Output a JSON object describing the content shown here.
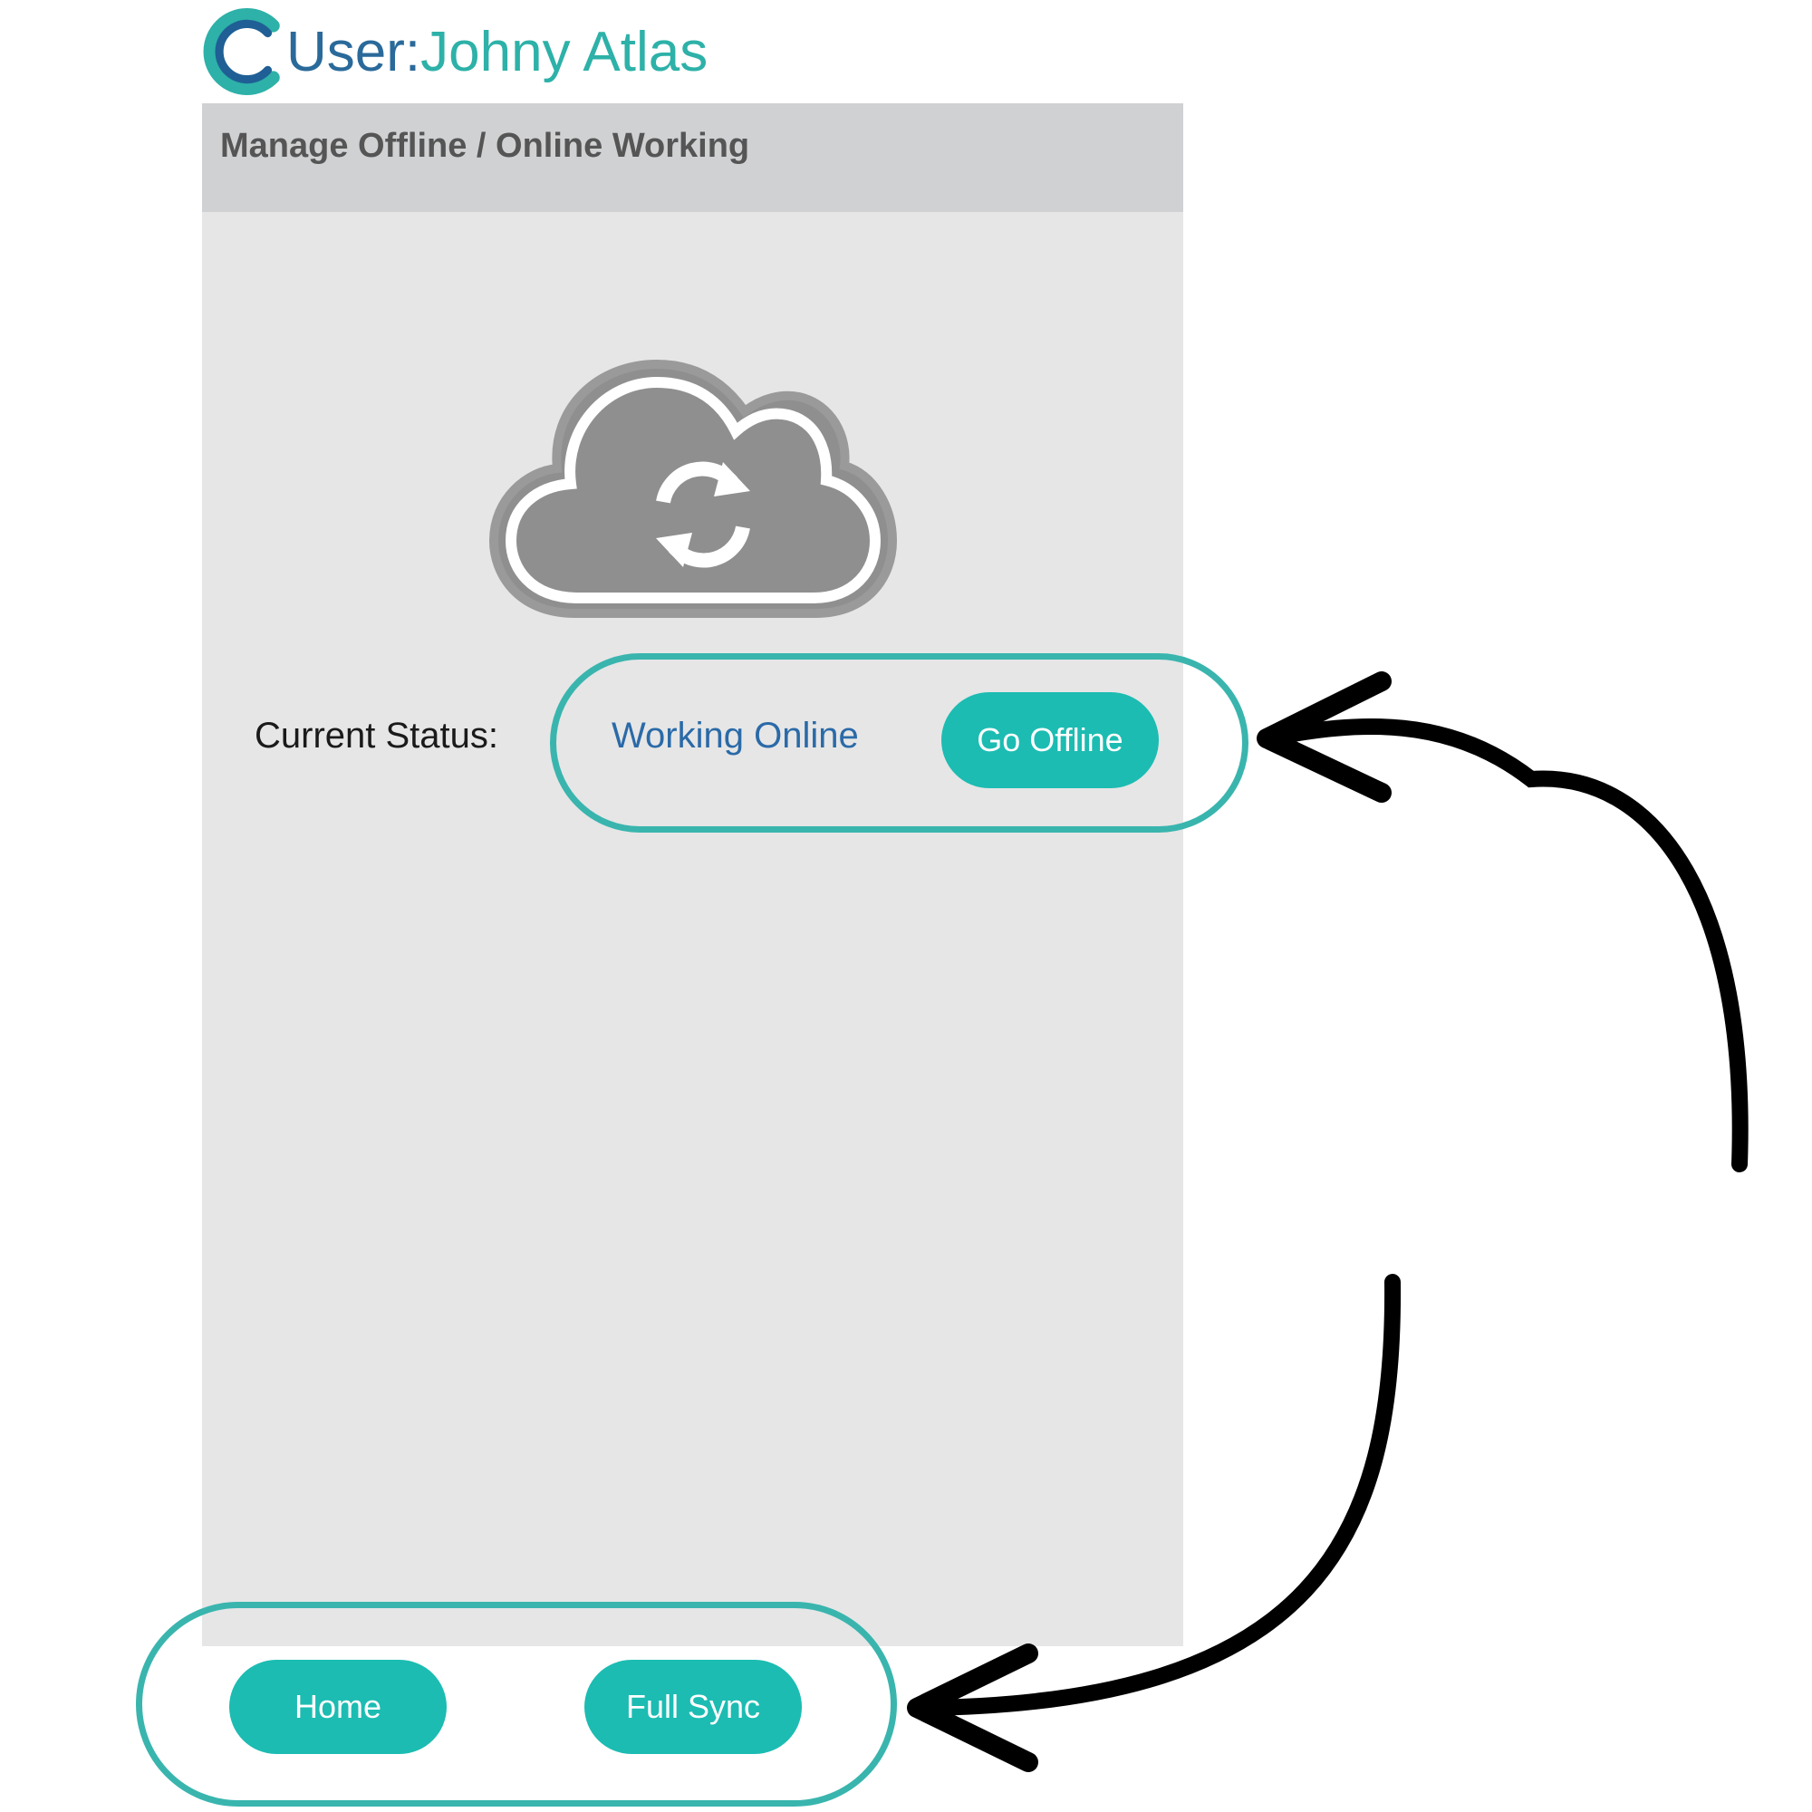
{
  "header": {
    "user_prefix": "User:",
    "user_name": "Johny Atlas",
    "logo_icon": "c-logo-icon"
  },
  "panel": {
    "title": "Manage Offline / Online Working",
    "cloud_icon": "cloud-sync-icon",
    "status_label": "Current Status:",
    "status_value": "Working Online",
    "go_offline_label": "Go Offline"
  },
  "nav": {
    "home_label": "Home",
    "full_sync_label": "Full Sync"
  },
  "colors": {
    "accent": "#1cbcb2",
    "highlight": "#39b5ae",
    "status_text": "#2a6aa8",
    "brand_blue": "#2a6a9a"
  }
}
